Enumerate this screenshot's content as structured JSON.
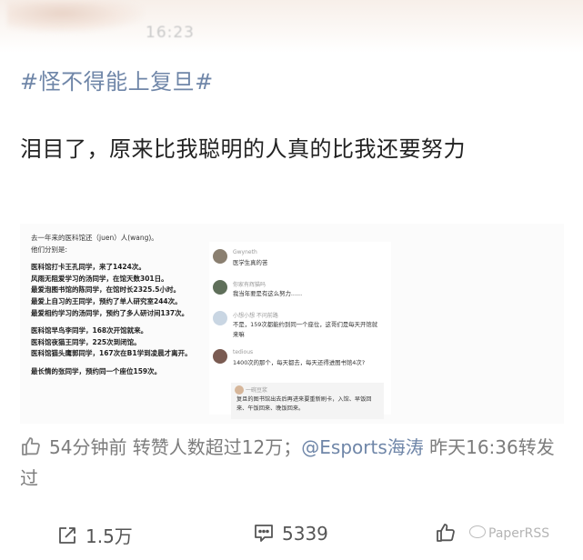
{
  "header": {
    "time": "16:23"
  },
  "post": {
    "hashtag": "#怪不得能上复旦#",
    "text": "泪目了，原来比我聪明的人真的比我还要努力"
  },
  "embedded": {
    "doc_intro": [
      "去一年来的医科馆还（juen）人(wang)。",
      "他们分别是:"
    ],
    "doc_lines": [
      "医科馆打卡王孔同学，来了1424次。",
      "风雨无阻爱学习的汤同学，在馆天数301日。",
      "最爱泡图书馆的陈同学，在馆时长2325.5小时。",
      "最爱上自习的王同学，预约了单人研究室244次。",
      "最爱相约学习的汤同学，预约了多人研讨间137次。",
      "医科馆早鸟李同学，168次开馆就来。",
      "医科馆夜猫王同学，225次到闭馆。",
      "医科馆猫头鹰郭同学，167次在B1学到凌晨才离开。",
      "最长情的张同学，预约同一个座位159次。"
    ],
    "comments": [
      {
        "name": "Gwyneth",
        "text": "医学生真的苦"
      },
      {
        "name": "你家有辉猫吗",
        "text": "我当年要是有这么努力......"
      },
      {
        "name": "小想小想 不问前路",
        "text": "不是，159次都能约到同一个座位，这哥们是每天开馆就来嘛"
      },
      {
        "name": "tedious",
        "text": "1400次的那个，每天都去，每天还得进图书馆4次?"
      }
    ],
    "reply": {
      "name": "一碗豆浆",
      "text": "复旦的图书馆出去后再进来要重新刷卡，入馆、早饭回来、午饭回来、晚饭回来。"
    }
  },
  "repost": {
    "prefix": "54分钟前 转赞人数超过12万；",
    "mention": "@Esports海涛",
    "suffix": " 昨天16:36转发过"
  },
  "actions": {
    "share_count": "1.5万",
    "comment_count": "5339"
  },
  "watermark": {
    "text": "PaperRSS"
  },
  "colors": {
    "hashtag": "#6f86a8",
    "meta": "#7c7c7c"
  }
}
